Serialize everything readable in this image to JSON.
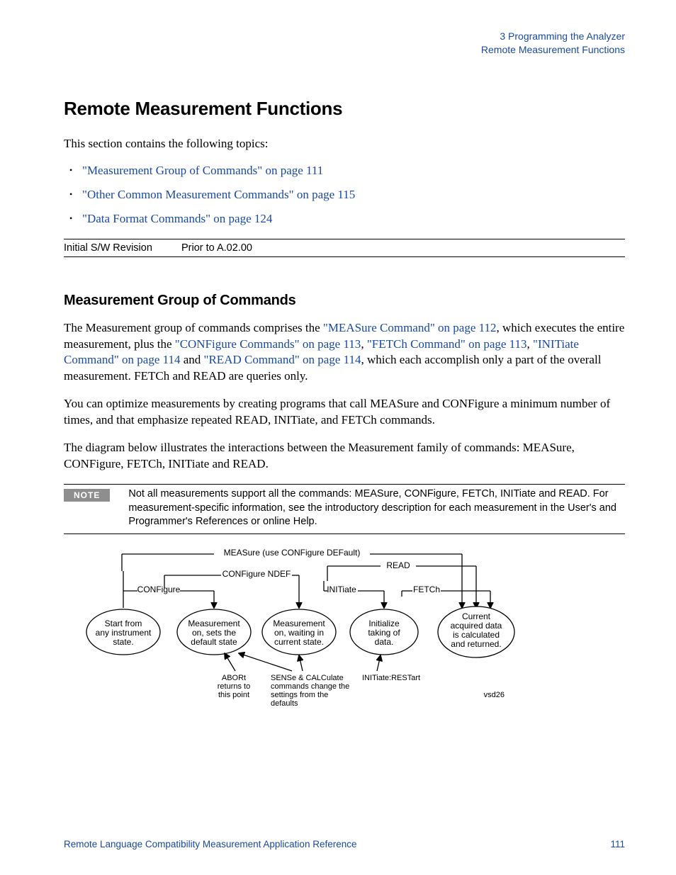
{
  "header": {
    "chapter": "3  Programming the Analyzer",
    "section": "Remote Measurement Functions"
  },
  "title": "Remote Measurement Functions",
  "intro": "This section contains the following topics:",
  "toc": [
    "\"Measurement Group of Commands\" on page 111",
    "\"Other Common Measurement Commands\" on page 115",
    "\"Data Format Commands\" on page 124"
  ],
  "revision": {
    "label": "Initial S/W Revision",
    "value": "Prior to A.02.00"
  },
  "subhead": "Measurement Group of Commands",
  "para1": {
    "t1": "The Measurement group of commands comprises the ",
    "l1": "\"MEASure Command\" on page 112",
    "t2": ", which executes the entire measurement, plus the ",
    "l2": "\"CONFigure Commands\" on page 113",
    "t3": ", ",
    "l3": "\"FETCh Command\" on page 113",
    "t4": ", ",
    "l4": "\"INITiate Command\" on page 114",
    "t5": " and ",
    "l5": "\"READ Command\" on page 114",
    "t6": ", which each accomplish only a part of the overall measurement. FETCh and READ are queries only."
  },
  "para2": "You can optimize measurements by creating programs that call MEASure and CONFigure a minimum number of times, and that emphasize repeated READ, INITiate, and FETCh commands.",
  "para3": "The diagram below illustrates the interactions between the Measurement family of commands: MEASure, CONFigure, FETCh, INITiate and READ.",
  "note": {
    "badge": "NOTE",
    "text": "Not all measurements support all the commands: MEASure, CONFigure, FETCh, INITiate and READ. For measurement-specific information, see the introductory description for each measurement in the User's and Programmer's References or online Help."
  },
  "diagram": {
    "top1": "MEASure (use CONFigure DEFault)",
    "top2": "CONFigure NDEF",
    "top3": "CONFigure",
    "top4": "READ",
    "top5": "INITiate",
    "top6": "FETCh",
    "e1a": "Start from",
    "e1b": "any instrument",
    "e1c": "state.",
    "e2a": "Measurement",
    "e2b": "on, sets the",
    "e2c": "default state",
    "e3a": "Measurement",
    "e3b": "on, waiting in",
    "e3c": "current state.",
    "e4a": "Initialize",
    "e4b": "taking of",
    "e4c": "data.",
    "e5a": "Current",
    "e5b": "acquired data",
    "e5c": "is calculated",
    "e5d": "and returned.",
    "n1a": "ABORt",
    "n1b": "returns to",
    "n1c": "this point",
    "n2a": "SENSe & CALCulate",
    "n2b": "commands change the",
    "n2c": "settings from the",
    "n2d": "defaults",
    "n3": "INITiate:RESTart",
    "tag": "vsd26"
  },
  "footer": {
    "doc": "Remote Language Compatibility Measurement Application Reference",
    "page": "111"
  }
}
